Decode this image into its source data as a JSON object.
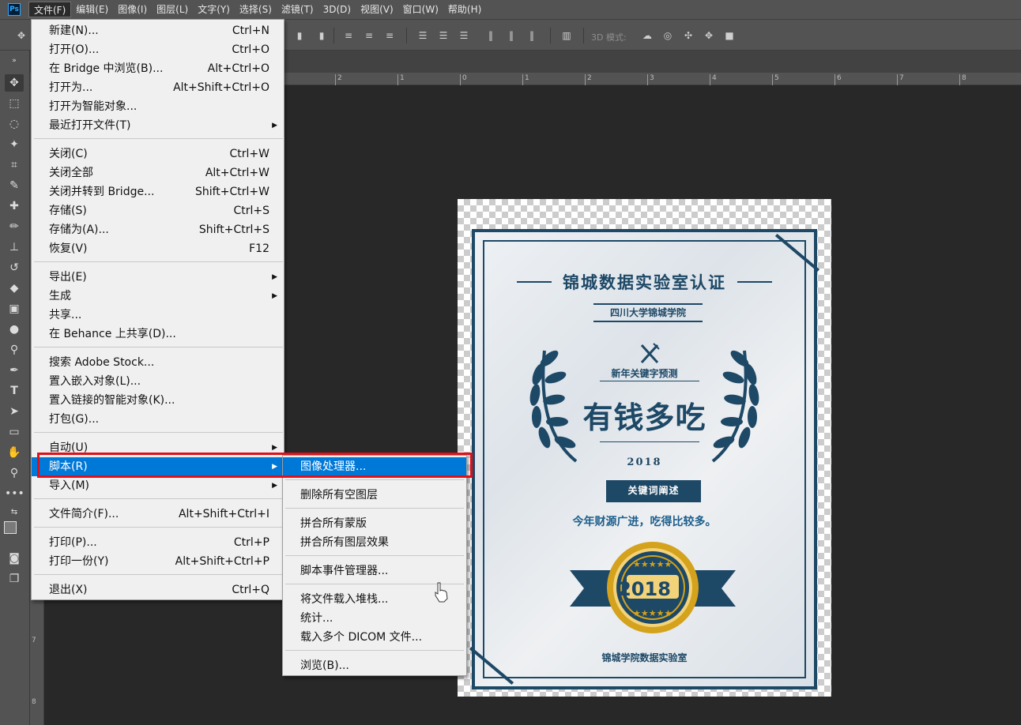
{
  "app": {
    "logo": "Ps"
  },
  "menubar": {
    "items": [
      "文件(F)",
      "编辑(E)",
      "图像(I)",
      "图层(L)",
      "文字(Y)",
      "选择(S)",
      "滤镜(T)",
      "3D(D)",
      "视图(V)",
      "窗口(W)",
      "帮助(H)"
    ],
    "active_index": 0
  },
  "options_bar": {
    "mode3d_label": "3D 模式:"
  },
  "ruler": {
    "top_ticks": [
      "2",
      "1",
      "0",
      "1",
      "2",
      "3",
      "4",
      "5",
      "6",
      "7",
      "8"
    ],
    "left_ticks": [
      "7",
      "8"
    ]
  },
  "file_menu": {
    "items": [
      {
        "label": "新建(N)...",
        "shortcut": "Ctrl+N"
      },
      {
        "label": "打开(O)...",
        "shortcut": "Ctrl+O"
      },
      {
        "label": "在 Bridge 中浏览(B)...",
        "shortcut": "Alt+Ctrl+O"
      },
      {
        "label": "打开为...",
        "shortcut": "Alt+Shift+Ctrl+O"
      },
      {
        "label": "打开为智能对象...",
        "shortcut": ""
      },
      {
        "label": "最近打开文件(T)",
        "shortcut": "",
        "submenu": true
      },
      {
        "label": "关闭(C)",
        "shortcut": "Ctrl+W"
      },
      {
        "label": "关闭全部",
        "shortcut": "Alt+Ctrl+W"
      },
      {
        "label": "关闭并转到 Bridge...",
        "shortcut": "Shift+Ctrl+W"
      },
      {
        "label": "存储(S)",
        "shortcut": "Ctrl+S"
      },
      {
        "label": "存储为(A)...",
        "shortcut": "Shift+Ctrl+S"
      },
      {
        "label": "恢复(V)",
        "shortcut": "F12"
      },
      {
        "label": "导出(E)",
        "shortcut": "",
        "submenu": true
      },
      {
        "label": "生成",
        "shortcut": "",
        "submenu": true
      },
      {
        "label": "共享...",
        "shortcut": ""
      },
      {
        "label": "在 Behance 上共享(D)...",
        "shortcut": ""
      },
      {
        "label": "搜索 Adobe Stock...",
        "shortcut": ""
      },
      {
        "label": "置入嵌入对象(L)...",
        "shortcut": ""
      },
      {
        "label": "置入链接的智能对象(K)...",
        "shortcut": ""
      },
      {
        "label": "打包(G)...",
        "shortcut": ""
      },
      {
        "label": "自动(U)",
        "shortcut": "",
        "submenu": true
      },
      {
        "label": "脚本(R)",
        "shortcut": "",
        "submenu": true,
        "highlighted": true
      },
      {
        "label": "导入(M)",
        "shortcut": "",
        "submenu": true
      },
      {
        "label": "文件简介(F)...",
        "shortcut": "Alt+Shift+Ctrl+I"
      },
      {
        "label": "打印(P)...",
        "shortcut": "Ctrl+P"
      },
      {
        "label": "打印一份(Y)",
        "shortcut": "Alt+Shift+Ctrl+P"
      },
      {
        "label": "退出(X)",
        "shortcut": "Ctrl+Q"
      }
    ]
  },
  "script_submenu": {
    "items": [
      {
        "label": "图像处理器...",
        "highlighted": true
      },
      {
        "label": "删除所有空图层"
      },
      {
        "label": "拼合所有蒙版"
      },
      {
        "label": "拼合所有图层效果"
      },
      {
        "label": "脚本事件管理器..."
      },
      {
        "label": "将文件载入堆栈..."
      },
      {
        "label": "统计..."
      },
      {
        "label": "载入多个 DICOM 文件..."
      },
      {
        "label": "浏览(B)..."
      }
    ]
  },
  "certificate": {
    "title": "锦城数据实验室认证",
    "school": "四川大学锦城学院",
    "subtitle": "新年关键字预测",
    "main": "有钱多吃",
    "year": "2018",
    "badge": "关键词阐述",
    "description": "今年财源广进，吃得比较多。",
    "seal_year": "2018",
    "footer": "锦城学院数据实验室",
    "colors": {
      "navy": "#1d4866",
      "gold": "#d4a21c"
    }
  },
  "colors": {
    "highlight": "#0078d7",
    "annotation_box": "#e0101a"
  }
}
